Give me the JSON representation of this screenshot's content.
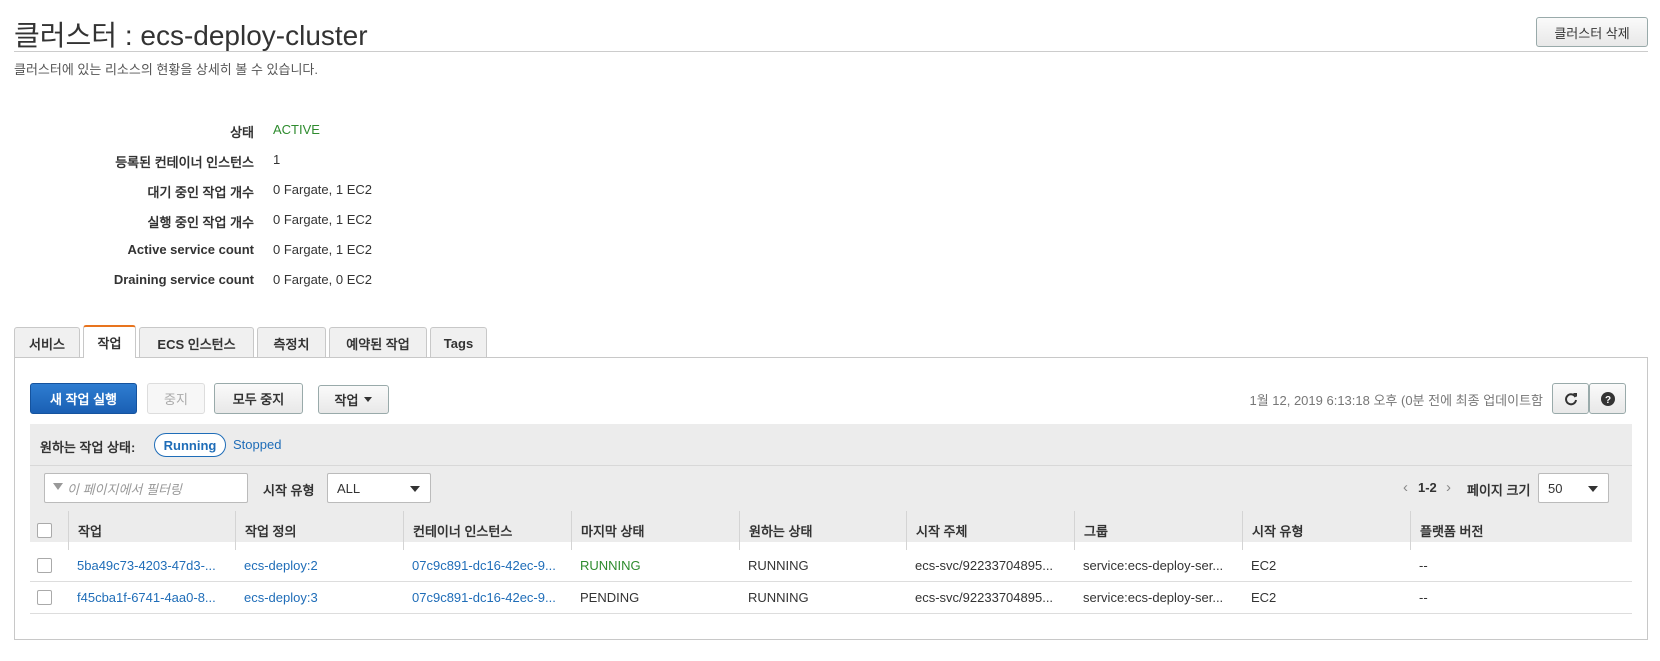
{
  "header": {
    "title": "클러스터 : ecs-deploy-cluster",
    "subtitle": "클러스터에 있는 리소스의 현황을 상세히 볼 수 있습니다.",
    "delete_button": "클러스터 삭제"
  },
  "details": [
    {
      "label": "상태",
      "value": "ACTIVE"
    },
    {
      "label": "등록된 컨테이너 인스턴스",
      "value": "1"
    },
    {
      "label": "대기 중인 작업 개수",
      "value": "0 Fargate, 1 EC2"
    },
    {
      "label": "실행 중인 작업 개수",
      "value": "0 Fargate, 1 EC2"
    },
    {
      "label": "Active service count",
      "value": "0 Fargate, 1 EC2"
    },
    {
      "label": "Draining service count",
      "value": "0 Fargate, 0 EC2"
    }
  ],
  "tabs": [
    "서비스",
    "작업",
    "ECS 인스턴스",
    "측정치",
    "예약된 작업",
    "Tags"
  ],
  "selected_tab": "작업",
  "toolbar": {
    "run_task": "새 작업 실행",
    "stop": "중지",
    "stop_all": "모두 중지",
    "actions": "작업",
    "last_updated": "1월 12, 2019 6:13:18 오후 (0분 전에 최종 업데이트함"
  },
  "filter": {
    "desired_state_label": "원하는 작업 상태:",
    "running": "Running",
    "stopped": "Stopped",
    "search_placeholder": "이 페이지에서 필터링",
    "launch_type_label": "시작 유형",
    "launch_type_value": "ALL",
    "page_range": "1-2",
    "page_size_label": "페이지 크기",
    "page_size_value": "50"
  },
  "table": {
    "columns": [
      "작업",
      "작업 정의",
      "컨테이너 인스턴스",
      "마지막 상태",
      "원하는 상태",
      "시작 주체",
      "그룹",
      "시작 유형",
      "플랫폼 버전"
    ],
    "rows": [
      [
        "5ba49c73-4203-47d3-...",
        "ecs-deploy:2",
        "07c9c891-dc16-42ec-9...",
        "RUNNING",
        "RUNNING",
        "ecs-svc/92233704895...",
        "service:ecs-deploy-ser...",
        "EC2",
        "--"
      ],
      [
        "f45cba1f-6741-4aa0-8...",
        "ecs-deploy:3",
        "07c9c891-dc16-42ec-9...",
        "PENDING",
        "RUNNING",
        "ecs-svc/92233704895...",
        "service:ecs-deploy-ser...",
        "EC2",
        "--"
      ]
    ]
  },
  "colors": {
    "accent": "#1f6db8",
    "active": "#2e8b2e",
    "tab_highlight": "#e8741e"
  }
}
